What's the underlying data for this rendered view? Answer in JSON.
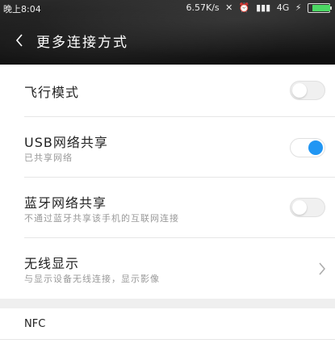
{
  "status_bar": {
    "time": "晚上8:04",
    "speed": "6.57K/s",
    "network": "4G"
  },
  "header": {
    "title": "更多连接方式"
  },
  "settings": [
    {
      "title": "飞行模式",
      "subtitle": "",
      "control": "toggle",
      "on": false
    },
    {
      "title": "USB网络共享",
      "subtitle": "已共享网络",
      "control": "toggle",
      "on": true
    },
    {
      "title": "蓝牙网络共享",
      "subtitle": "不通过蓝牙共享该手机的互联网连接",
      "control": "toggle",
      "on": false
    },
    {
      "title": "无线显示",
      "subtitle": "与显示设备无线连接，显示影像",
      "control": "chevron"
    }
  ],
  "nfc": {
    "label": "NFC"
  },
  "colors": {
    "accent": "#2196f3",
    "header_bg": "#1a1a1a"
  }
}
